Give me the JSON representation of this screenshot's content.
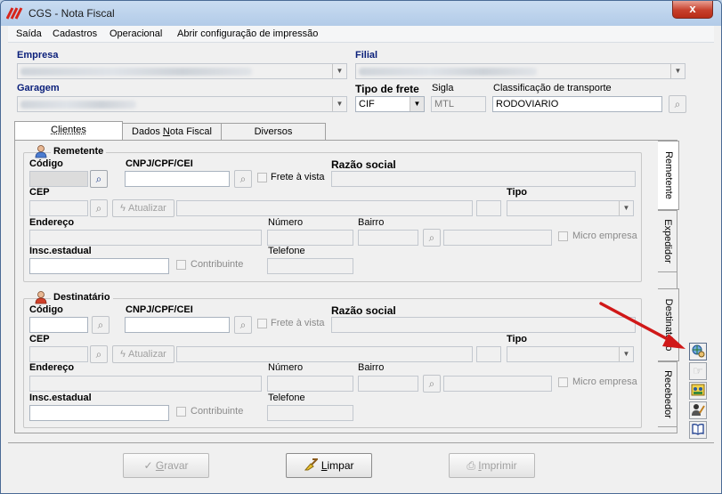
{
  "window": {
    "title": "CGS - Nota Fiscal",
    "close_label": "x"
  },
  "menu": {
    "items": [
      "Saída",
      "Cadastros",
      "Operacional",
      "Abrir configuração de impressão"
    ]
  },
  "header": {
    "empresa_label": "Empresa",
    "filial_label": "Filial",
    "garagem_label": "Garagem",
    "tipo_frete_label": "Tipo de frete",
    "tipo_frete_value": "CIF",
    "sigla_label": "Sigla",
    "sigla_value": "MTL",
    "classificacao_label": "Classificação de transporte",
    "classificacao_value": "RODOVIARIO"
  },
  "tabs": {
    "items": [
      "Clientes",
      "Dados Nota Fiscal",
      "Diversos"
    ],
    "selected": "Clientes",
    "dados_pre": "Dados ",
    "dados_u": "N",
    "dados_post": "ota Fiscal"
  },
  "side_tabs": [
    "Remetente",
    "Expedidor",
    "Destinatário",
    "Recebedor"
  ],
  "remetente": {
    "title": "Remetente",
    "codigo_label": "Código",
    "cnpj_label": "CNPJ/CPF/CEI",
    "frete_vista_label": "Frete à vista",
    "razao_label": "Razão social",
    "cep_label": "CEP",
    "atualizar_label": "Atualizar",
    "tipo_label": "Tipo",
    "endereco_label": "Endereço",
    "numero_label": "Número",
    "bairro_label": "Bairro",
    "micro_label": "Micro empresa",
    "insc_label": "Insc.estadual",
    "contribuinte_label": "Contribuinte",
    "telefone_label": "Telefone"
  },
  "destinatario": {
    "title": "Destinatário",
    "codigo_label": "Código",
    "cnpj_label": "CNPJ/CPF/CEI",
    "frete_vista_label": "Frete à vista",
    "razao_label": "Razão social",
    "cep_label": "CEP",
    "atualizar_label": "Atualizar",
    "tipo_label": "Tipo",
    "endereco_label": "Endereço",
    "numero_label": "Número",
    "bairro_label": "Bairro",
    "micro_label": "Micro empresa",
    "insc_label": "Insc.estadual",
    "contribuinte_label": "Contribuinte",
    "telefone_label": "Telefone"
  },
  "footer": {
    "gravar_u": "G",
    "gravar_rest": "ravar",
    "limpar_u": "L",
    "limpar_rest": "impar",
    "imprimir_u": "I",
    "imprimir_rest": "mprimir"
  },
  "icons": {
    "binoculars": "binoculars-icon",
    "atualizar": "lightning-icon",
    "person": "person-icon",
    "check": "check-icon",
    "broom": "broom-icon",
    "printer": "printer-icon"
  },
  "colors": {
    "label_blue": "#0a1f7a",
    "arrow_red": "#d01818",
    "title_bar": "#b2cbe8",
    "close_red": "#c7402c"
  }
}
